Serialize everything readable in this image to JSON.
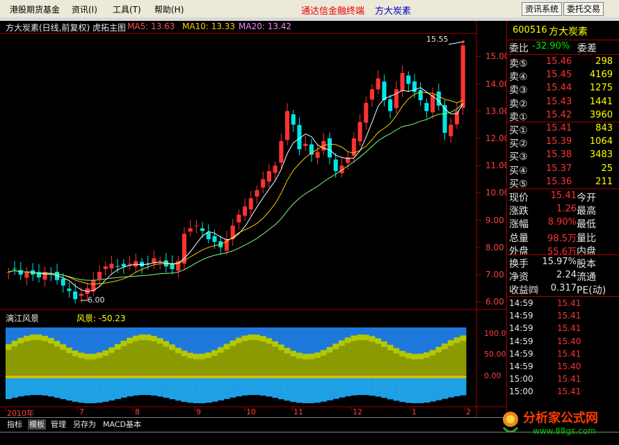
{
  "menu": {
    "items": [
      "港股期货基金",
      "资讯(I)",
      "工具(T)",
      "帮助(H)"
    ],
    "promo": "通达信金融终端",
    "stock_title": "方大炭素",
    "buttons": [
      "资讯系统",
      "委托交易"
    ]
  },
  "chart": {
    "header_title": "方大炭素(日线,前复权) 虎拓主图",
    "ma5": "MA5: 13.63",
    "ma10": "MA10: 13.33",
    "ma20": "MA20: 13.42",
    "high_label": "15.55",
    "low_label": "6.00",
    "y_ticks": [
      "15.00",
      "14.00",
      "13.00",
      "12.00",
      "11.00",
      "10.00",
      "9.00",
      "8.00",
      "7.00",
      "6.00"
    ],
    "x_ticks": [
      "2010年",
      "7",
      "8",
      "9",
      "10",
      "11",
      "12",
      "1",
      "2"
    ],
    "indicator_name": "漓江风景",
    "indicator_value_label": "风景: -50.23",
    "indicator_ticks": [
      "100.0",
      "50.00",
      "0.00"
    ]
  },
  "chart_data": {
    "type": "candlestick",
    "title": "方大炭素(日线,前复权)",
    "ylim": [
      5.8,
      15.8
    ],
    "x_labels": [
      "2010年",
      "7",
      "8",
      "9",
      "10",
      "11",
      "12",
      "1",
      "2"
    ],
    "close_series_approx": [
      7.1,
      7.2,
      7.0,
      7.1,
      7.0,
      6.9,
      7.1,
      7.0,
      6.8,
      6.6,
      6.4,
      6.1,
      6.3,
      6.5,
      6.8,
      7.1,
      7.3,
      7.4,
      7.3,
      7.3,
      7.4,
      7.5,
      7.3,
      7.4,
      7.6,
      7.5,
      7.3,
      7.2,
      7.5,
      8.5,
      8.7,
      8.8,
      8.6,
      8.3,
      8.2,
      8.0,
      8.3,
      8.8,
      9.2,
      9.5,
      9.8,
      10.1,
      10.5,
      10.8,
      11.0,
      11.9,
      13.0,
      12.5,
      11.6,
      11.8,
      11.4,
      11.5,
      11.9,
      11.3,
      10.8,
      11.0,
      11.3,
      12.0,
      12.6,
      13.3,
      13.8,
      14.2,
      13.4,
      13.0,
      13.8,
      14.4,
      14.0,
      13.7,
      13.4,
      13.0,
      13.6,
      13.2,
      12.2,
      12.5,
      13.0,
      15.41
    ],
    "high": 15.55,
    "low": 6.0
  },
  "quote": {
    "code": "600516",
    "name": "方大炭素",
    "weibi_label": "委比",
    "weibi_value": "-32.90%",
    "weicha_label": "委差",
    "sell": [
      {
        "label": "卖⑤",
        "price": "15.46",
        "vol": "298"
      },
      {
        "label": "卖④",
        "price": "15.45",
        "vol": "4169"
      },
      {
        "label": "卖③",
        "price": "15.44",
        "vol": "1275"
      },
      {
        "label": "卖②",
        "price": "15.43",
        "vol": "1441"
      },
      {
        "label": "卖①",
        "price": "15.42",
        "vol": "3960"
      }
    ],
    "buy": [
      {
        "label": "买①",
        "price": "15.41",
        "vol": "843"
      },
      {
        "label": "买②",
        "price": "15.39",
        "vol": "1064"
      },
      {
        "label": "买③",
        "price": "15.38",
        "vol": "3483"
      },
      {
        "label": "买④",
        "price": "15.37",
        "vol": "25"
      },
      {
        "label": "买⑤",
        "price": "15.36",
        "vol": "211"
      }
    ],
    "stats1": [
      {
        "l": "现价",
        "v": "15.41",
        "r": "今开"
      },
      {
        "l": "涨跌",
        "v": "1.26",
        "r": "最高"
      },
      {
        "l": "涨幅",
        "v": "8.90%",
        "r": "最低"
      },
      {
        "l": "总量",
        "v": "98.5万",
        "r": "量比"
      },
      {
        "l": "外盘",
        "v": "55.6万",
        "r": "内盘"
      }
    ],
    "stats2": [
      {
        "l": "换手",
        "v": "15.97%",
        "r": "股本"
      },
      {
        "l": "净资",
        "v": "2.24",
        "r": "流通"
      },
      {
        "l": "收益㈣",
        "v": "0.317",
        "r": "PE(动)"
      }
    ],
    "trades": [
      {
        "t": "14:59",
        "p": "15.41",
        "c": "red"
      },
      {
        "t": "14:59",
        "p": "15.41",
        "c": "red"
      },
      {
        "t": "14:59",
        "p": "15.41",
        "c": "red"
      },
      {
        "t": "14:59",
        "p": "15.40",
        "c": "red"
      },
      {
        "t": "14:59",
        "p": "15.41",
        "c": "red"
      },
      {
        "t": "14:59",
        "p": "15.40",
        "c": "red"
      },
      {
        "t": "15:00",
        "p": "15.41",
        "c": "red"
      },
      {
        "t": "15:00",
        "p": "15.41",
        "c": "red"
      }
    ]
  },
  "bottom_tabs": [
    "指标",
    "模板",
    "管理",
    "另存为",
    "MACD基本"
  ],
  "watermark": {
    "text": "分析家公式网",
    "url": "www.88gs.com"
  }
}
